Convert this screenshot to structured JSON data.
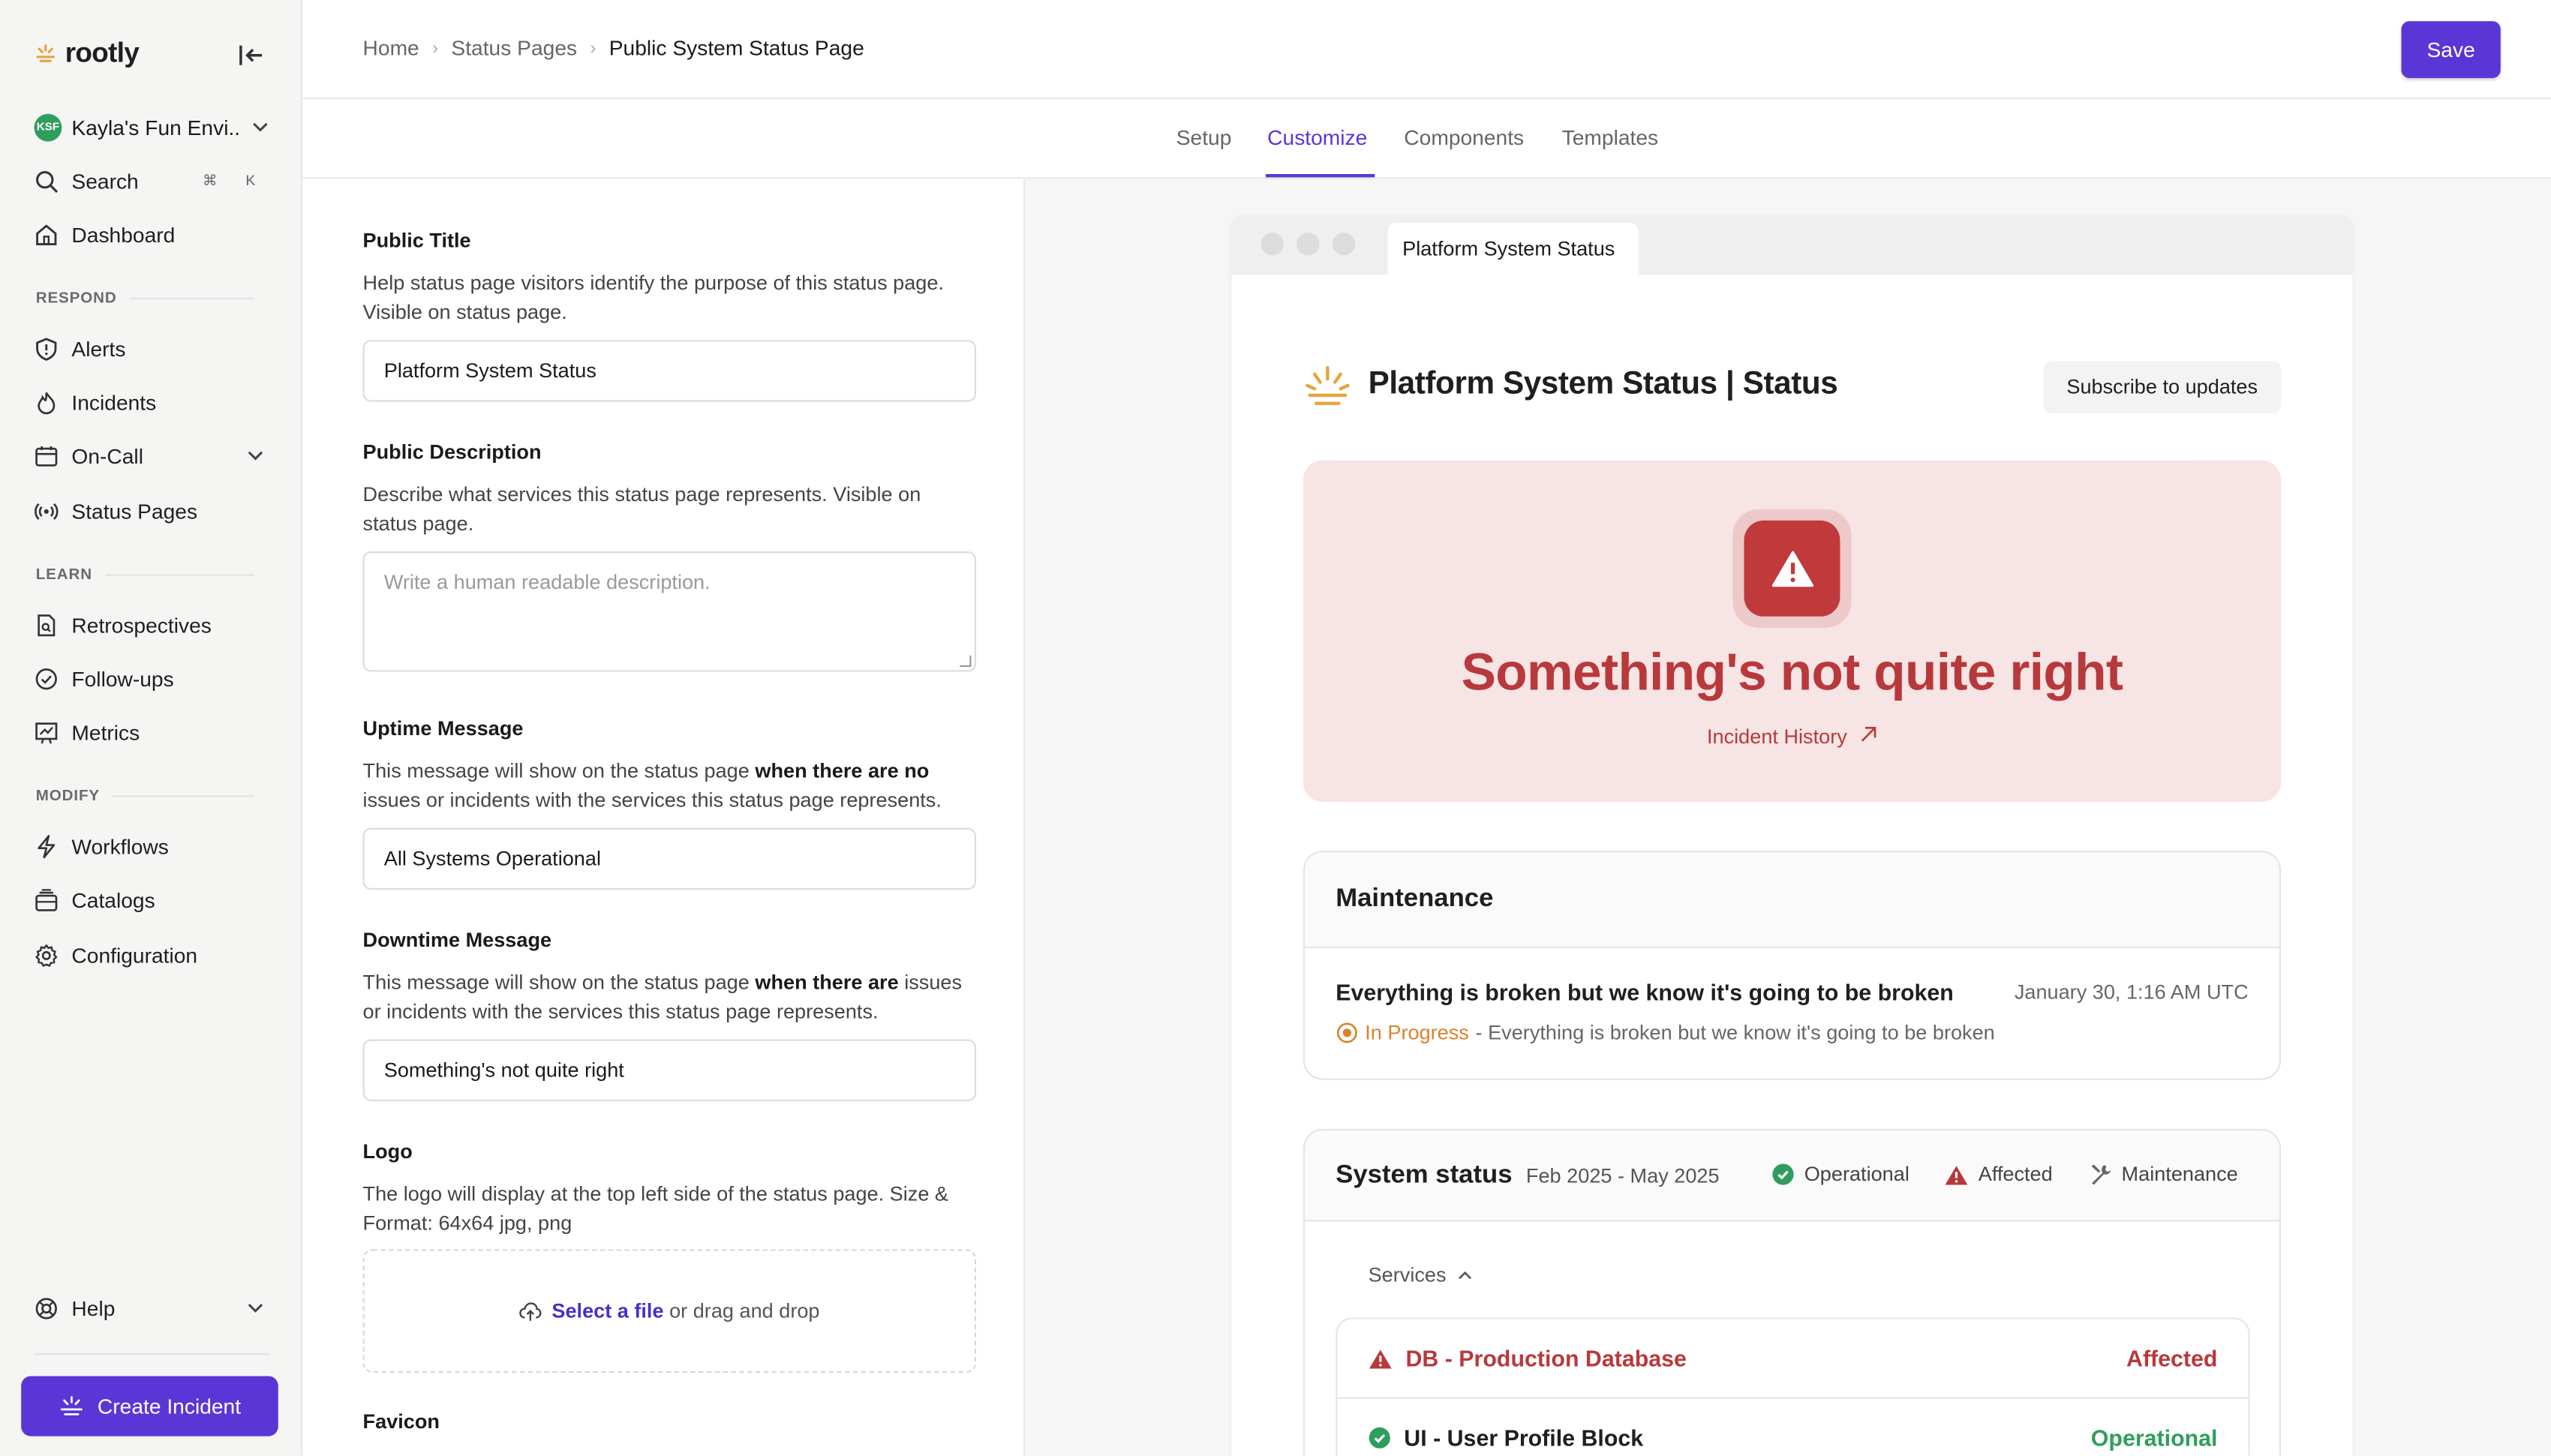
{
  "app": {
    "brand": "rootly",
    "environment": "Kayla's Fun Envi...",
    "environment_initials": "KSF"
  },
  "sidebar": {
    "search_label": "Search",
    "search_kbd_1": "⌘",
    "search_kbd_2": "K",
    "dashboard": "Dashboard",
    "sections": {
      "respond": "RESPOND",
      "learn": "LEARN",
      "modify": "MODIFY"
    },
    "respond_items": [
      "Alerts",
      "Incidents",
      "On-Call",
      "Status Pages"
    ],
    "learn_items": [
      "Retrospectives",
      "Follow-ups",
      "Metrics"
    ],
    "modify_items": [
      "Workflows",
      "Catalogs",
      "Configuration"
    ],
    "help": "Help",
    "create_incident": "Create Incident"
  },
  "header": {
    "breadcrumb": [
      "Home",
      "Status Pages",
      "Public System Status Page"
    ],
    "save_label": "Save"
  },
  "tabs": {
    "items": [
      "Setup",
      "Customize",
      "Components",
      "Templates"
    ],
    "active": "Customize"
  },
  "form": {
    "public_title": {
      "label": "Public Title",
      "help": "Help status page visitors identify the purpose of this status page. Visible on status page.",
      "value": "Platform System Status"
    },
    "public_description": {
      "label": "Public Description",
      "help": "Describe what services this status page represents. Visible on status page.",
      "placeholder": "Write a human readable description."
    },
    "uptime_message": {
      "label": "Uptime Message",
      "help_prefix": "This message will show on the status page ",
      "help_bold": "when there are no",
      "help_suffix": " issues or incidents with the services this status page represents.",
      "value": "All Systems Operational"
    },
    "downtime_message": {
      "label": "Downtime Message",
      "help_prefix": "This message will show on the status page ",
      "help_bold": "when there are",
      "help_suffix": " issues or incidents with the services this status page represents.",
      "value": "Something's not quite right"
    },
    "logo": {
      "label": "Logo",
      "help": "The logo will display at the top left side of the status page. Size & Format: 64x64 jpg, png",
      "select_link": "Select a file",
      "drop_text": " or drag and drop"
    },
    "favicon": {
      "label": "Favicon"
    }
  },
  "preview": {
    "browser_tab": "Platform System Status",
    "page_title": "Platform System Status | Status",
    "subscribe": "Subscribe to updates",
    "alert_message": "Something's not quite right",
    "incident_history": "Incident History",
    "maintenance": {
      "title": "Maintenance",
      "item_title": "Everything is broken but we know it's going to be broken",
      "date": "January 30, 1:16 AM UTC",
      "status": "In Progress",
      "status_detail": "- Everything is broken but we know it's going to be broken"
    },
    "system_status": {
      "title": "System status",
      "range": "Feb 2025 - May 2025",
      "legend": [
        "Operational",
        "Affected",
        "Maintenance"
      ],
      "services_label": "Services",
      "services": [
        {
          "name": "DB - Production Database",
          "status": "Affected"
        },
        {
          "name": "UI - User Profile Block",
          "status": "Operational"
        }
      ]
    }
  },
  "colors": {
    "accent": "#5b36d6",
    "affected": "#b8393b",
    "operational": "#2f9e5d",
    "in_progress": "#d9822b"
  }
}
